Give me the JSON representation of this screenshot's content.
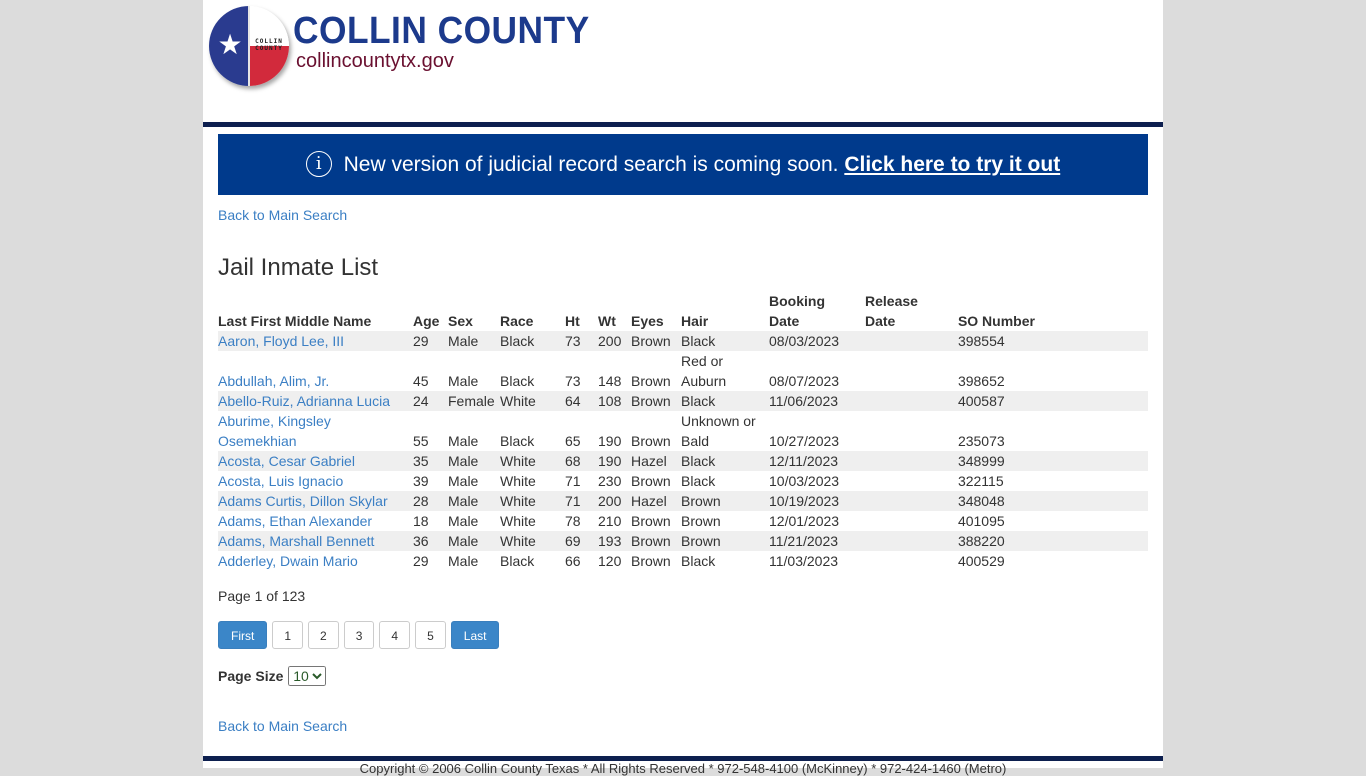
{
  "header": {
    "logo_mini_text": "COLLIN COUNTY",
    "brand_title": "COLLIN COUNTY",
    "brand_url": "collincountytx.gov"
  },
  "banner": {
    "icon": "info-icon",
    "message": "New version of judicial record search is coming soon.",
    "link_label": "Click here to try it out",
    "bg_color": "#003a8c"
  },
  "nav": {
    "back_top": "Back to Main Search",
    "back_bottom": "Back to Main Search"
  },
  "page_title": "Jail Inmate List",
  "table": {
    "columns": [
      "Last First Middle Name",
      "Age",
      "Sex",
      "Race",
      "Ht",
      "Wt",
      "Eyes",
      "Hair",
      "Booking Date",
      "Release Date",
      "SO Number"
    ],
    "rows": [
      {
        "name": "Aaron, Floyd Lee, III",
        "age": "29",
        "sex": "Male",
        "race": "Black",
        "ht": "73",
        "wt": "200",
        "eyes": "Brown",
        "hair": "Black",
        "booking": "08/03/2023",
        "release": "",
        "so": "398554"
      },
      {
        "name": "Abdullah, Alim, Jr.",
        "age": "45",
        "sex": "Male",
        "race": "Black",
        "ht": "73",
        "wt": "148",
        "eyes": "Brown",
        "hair": "Red or Auburn",
        "booking": "08/07/2023",
        "release": "",
        "so": "398652"
      },
      {
        "name": "Abello-Ruiz, Adrianna Lucia",
        "age": "24",
        "sex": "Female",
        "race": "White",
        "ht": "64",
        "wt": "108",
        "eyes": "Brown",
        "hair": "Black",
        "booking": "11/06/2023",
        "release": "",
        "so": "400587"
      },
      {
        "name": "Aburime, Kingsley Osemekhian",
        "age": "55",
        "sex": "Male",
        "race": "Black",
        "ht": "65",
        "wt": "190",
        "eyes": "Brown",
        "hair": "Unknown or Bald",
        "booking": "10/27/2023",
        "release": "",
        "so": "235073"
      },
      {
        "name": "Acosta, Cesar Gabriel",
        "age": "35",
        "sex": "Male",
        "race": "White",
        "ht": "68",
        "wt": "190",
        "eyes": "Hazel",
        "hair": "Black",
        "booking": "12/11/2023",
        "release": "",
        "so": "348999"
      },
      {
        "name": "Acosta, Luis Ignacio",
        "age": "39",
        "sex": "Male",
        "race": "White",
        "ht": "71",
        "wt": "230",
        "eyes": "Brown",
        "hair": "Black",
        "booking": "10/03/2023",
        "release": "",
        "so": "322115"
      },
      {
        "name": "Adams Curtis, Dillon Skylar",
        "age": "28",
        "sex": "Male",
        "race": "White",
        "ht": "71",
        "wt": "200",
        "eyes": "Hazel",
        "hair": "Brown",
        "booking": "10/19/2023",
        "release": "",
        "so": "348048"
      },
      {
        "name": "Adams, Ethan Alexander",
        "age": "18",
        "sex": "Male",
        "race": "White",
        "ht": "78",
        "wt": "210",
        "eyes": "Brown",
        "hair": "Brown",
        "booking": "12/01/2023",
        "release": "",
        "so": "401095"
      },
      {
        "name": "Adams, Marshall Bennett",
        "age": "36",
        "sex": "Male",
        "race": "White",
        "ht": "69",
        "wt": "193",
        "eyes": "Brown",
        "hair": "Brown",
        "booking": "11/21/2023",
        "release": "",
        "so": "388220"
      },
      {
        "name": "Adderley, Dwain Mario",
        "age": "29",
        "sex": "Male",
        "race": "Black",
        "ht": "66",
        "wt": "120",
        "eyes": "Brown",
        "hair": "Black",
        "booking": "11/03/2023",
        "release": "",
        "so": "400529"
      }
    ]
  },
  "pagination": {
    "info": "Page 1 of 123",
    "first_label": "First",
    "pages": [
      "1",
      "2",
      "3",
      "4",
      "5"
    ],
    "last_label": "Last",
    "page_size_label": "Page Size",
    "page_size_value": "10"
  },
  "footer": {
    "text": "Copyright © 2006 Collin County Texas * All Rights Reserved * 972-548-4100 (McKinney) * 972-424-1460 (Metro)"
  },
  "colors": {
    "link": "#3b7fc4",
    "navy": "#0d1f4f",
    "primary_button": "#3b86c8"
  }
}
